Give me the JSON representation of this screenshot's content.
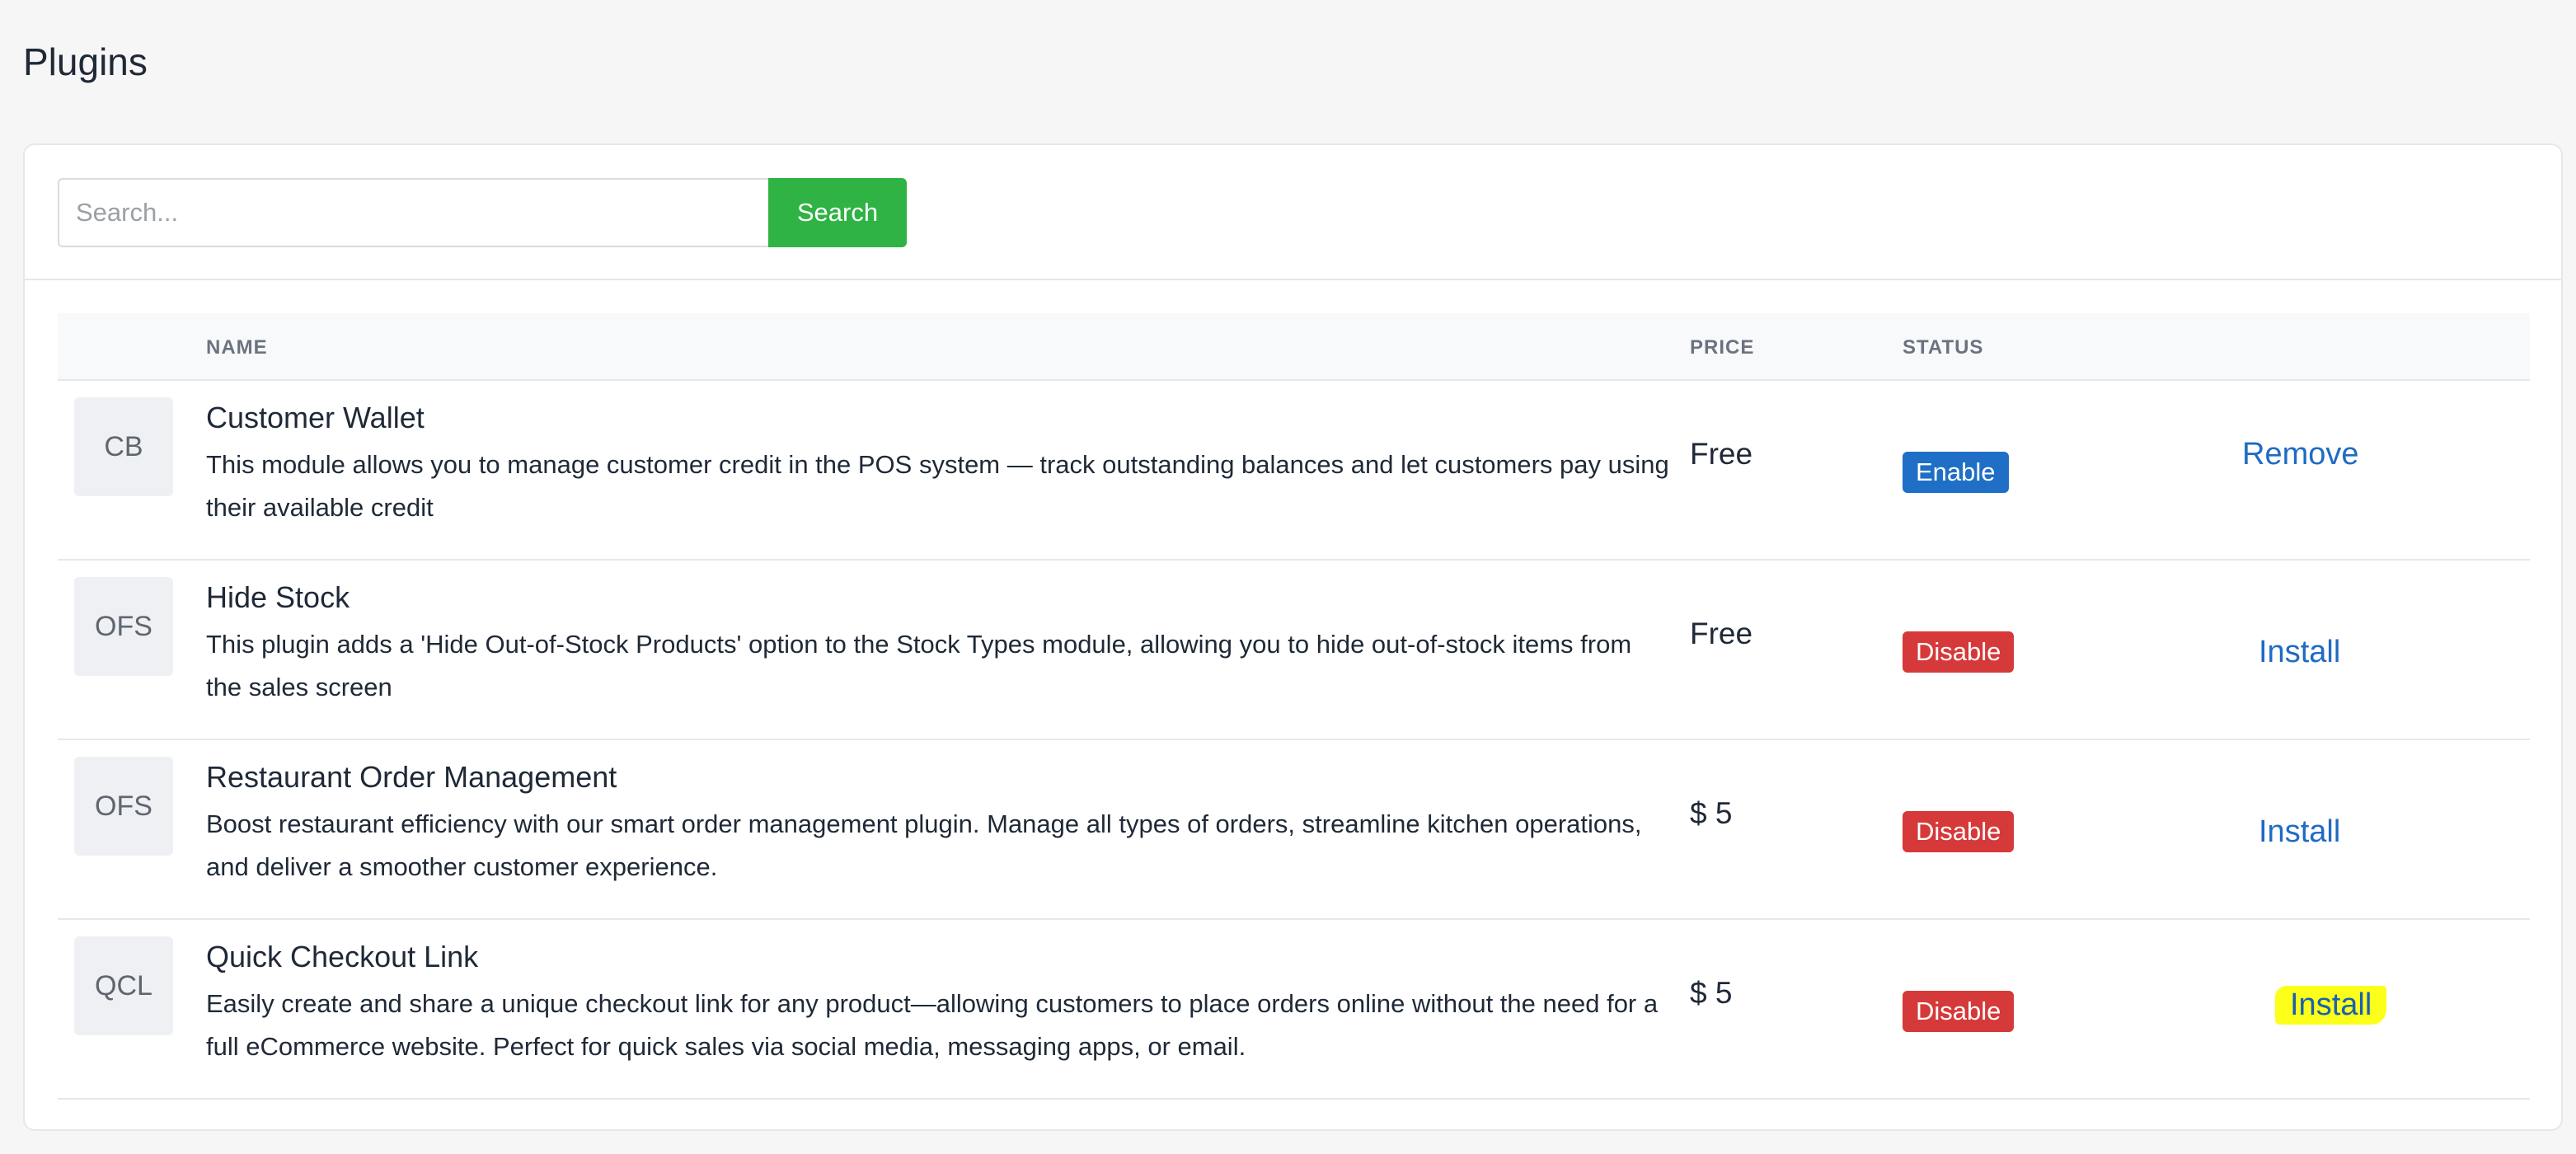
{
  "page": {
    "title": "Plugins"
  },
  "search": {
    "placeholder": "Search...",
    "value": "",
    "button_label": "Search"
  },
  "table": {
    "headers": {
      "name": "NAME",
      "price": "PRICE",
      "status": "STATUS"
    },
    "rows": [
      {
        "avatar": "CB",
        "name": "Customer Wallet",
        "description": "This module allows you to manage customer credit in the POS system — track outstanding balances and let customers pay using their available credit",
        "price": "Free",
        "status": "Enable",
        "action": "Remove"
      },
      {
        "avatar": "OFS",
        "name": "Hide Stock",
        "description": "This plugin adds a 'Hide Out-of-Stock Products' option to the Stock Types module, allowing you to hide out-of-stock items from the sales screen",
        "price": "Free",
        "status": "Disable",
        "action": "Install"
      },
      {
        "avatar": "OFS",
        "name": "Restaurant Order Management",
        "description": "Boost restaurant efficiency with our smart order management plugin. Manage all types of orders, streamline kitchen operations, and deliver a smoother customer experience.",
        "price": "$ 5",
        "status": "Disable",
        "action": "Install"
      },
      {
        "avatar": "QCL",
        "name": "Quick Checkout Link",
        "description": "Easily create and share a unique checkout link for any product—allowing customers to place orders online without the need for a full eCommerce website. Perfect for quick sales via social media, messaging apps, or email.",
        "price": "$ 5",
        "status": "Disable",
        "action": "Install"
      }
    ]
  },
  "colors": {
    "search_button": "#2fb344",
    "enable_badge": "#1e6fc5",
    "disable_badge": "#d63939",
    "link": "#206bc4",
    "highlight": "#fbff1a"
  }
}
